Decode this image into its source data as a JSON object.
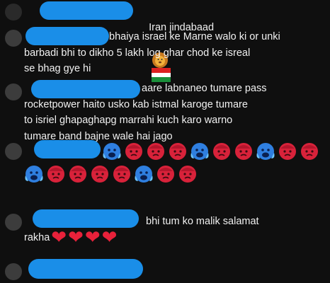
{
  "comments": [
    {
      "text": "Iran jindabaad",
      "emojis": [
        "flag-tajikistan-icon",
        "lion-face-icon"
      ]
    },
    {
      "line1": "bhaiya israel ke Marne walo ki or unki",
      "rest": "barbadi bhi to dikho 5 lakh log ghar chod ke isreal\nse bhag gye hi"
    },
    {
      "line1": "aare labnaneo tumare pass",
      "rest": "rocketpower haito usko kab istmal karoge tumare\nto isriel ghapaghapg marrahi kuch karo warno\ntumare band bajne wale hai jago"
    },
    {
      "emojis": [
        "crying-face",
        "pouting-face",
        "pouting-face",
        "pouting-face",
        "crying-face",
        "pouting-face",
        "pouting-face",
        "crying-face",
        "pouting-face",
        "pouting-face",
        "crying-face",
        "pouting-face",
        "pouting-face",
        "pouting-face",
        "pouting-face",
        "crying-face",
        "pouting-face",
        "pouting-face"
      ]
    },
    {
      "line1": "bhi tum ko malik salamat",
      "rest": "rakha",
      "hearts": [
        "❤",
        "❤",
        "❤",
        "❤"
      ]
    }
  ],
  "colors": {
    "background": "#0f0f0f",
    "redaction": "#1a8ee8",
    "heart": "#e8213a"
  }
}
